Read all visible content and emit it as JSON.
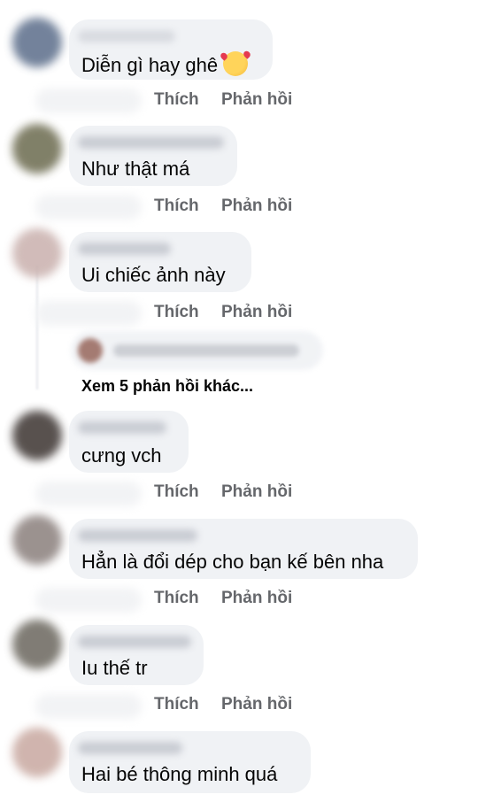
{
  "actions": {
    "like": "Thích",
    "reply": "Phản hồi"
  },
  "comments": [
    {
      "text": "Diễn gì hay ghê",
      "emoji": "smiling-face-with-hearts-icon",
      "avatar_color": "#5b6d8a"
    },
    {
      "text": "Như thật má",
      "avatar_color": "#6b6a4e"
    },
    {
      "text": "Ui chiếc ảnh này",
      "avatar_color": "#c9b0ad"
    },
    {
      "text": "cưng vch",
      "avatar_color": "#3b3330"
    },
    {
      "text": "Hẳn là đổi dép cho bạn kế bên nha",
      "avatar_color": "#8a7f7c"
    },
    {
      "text": "Iu thế tr",
      "avatar_color": "#6a665d"
    },
    {
      "text": "Hai bé thông minh quá",
      "avatar_color": "#c8a8a0"
    }
  ],
  "more_replies": "Xem 5 phản hồi khác..."
}
